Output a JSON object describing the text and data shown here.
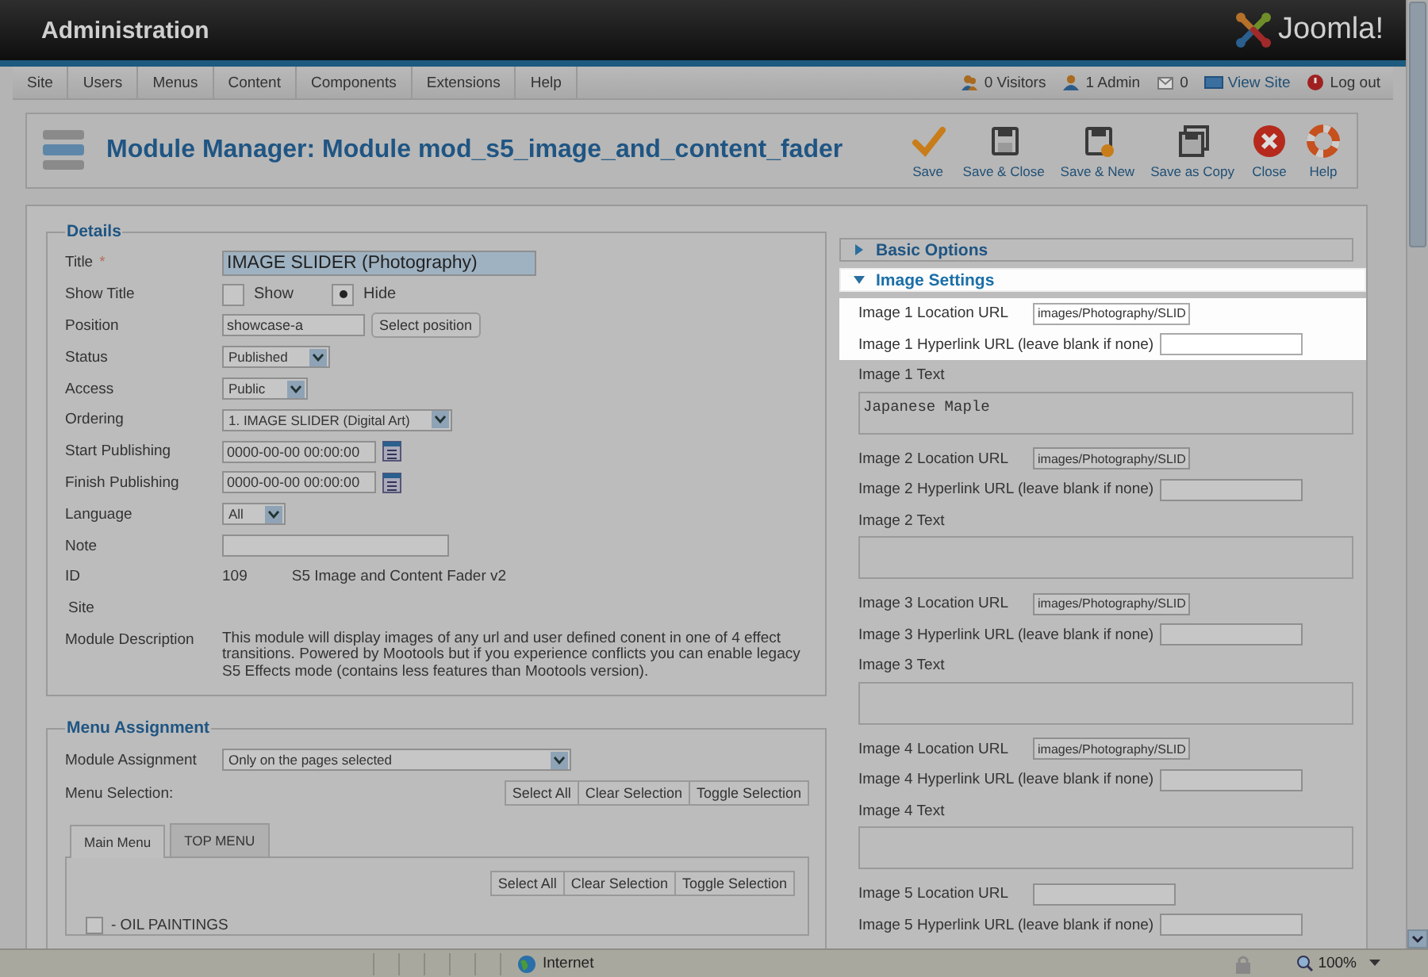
{
  "header": {
    "title": "Administration",
    "logo": "Joomla!"
  },
  "menu": [
    "Site",
    "Users",
    "Menus",
    "Content",
    "Components",
    "Extensions",
    "Help"
  ],
  "status_links": [
    {
      "label": "0 Visitors",
      "kind": "visitors"
    },
    {
      "label": "1 Admin",
      "kind": "admin"
    },
    {
      "label": "0",
      "kind": "messages"
    },
    {
      "label": "View Site",
      "kind": "view"
    },
    {
      "label": "Log out",
      "kind": "logout"
    }
  ],
  "toolbar": {
    "title": "Module Manager: Module mod_s5_image_and_content_fader",
    "buttons": [
      {
        "label": "Save",
        "kind": "save"
      },
      {
        "label": "Save & Close",
        "kind": "save_close"
      },
      {
        "label": "Save & New",
        "kind": "save_new"
      },
      {
        "label": "Save as Copy",
        "kind": "save_copy"
      },
      {
        "label": "Close",
        "kind": "close"
      },
      {
        "label": "Help",
        "kind": "help"
      }
    ]
  },
  "details": {
    "legend": "Details",
    "fields": [
      {
        "kind": "text",
        "label": "Title",
        "required": "*",
        "value": "IMAGE SLIDER (Photography)"
      },
      {
        "kind": "radio",
        "label": "Show Title",
        "options": [
          {
            "label": "Show",
            "selected": false
          },
          {
            "label": "Hide",
            "selected": true
          }
        ]
      },
      {
        "kind": "text_button",
        "label": "Position",
        "value": "showcase-a",
        "button": "Select position"
      },
      {
        "kind": "select",
        "label": "Status",
        "value": "Published"
      },
      {
        "kind": "select",
        "label": "Access",
        "value": "Public"
      },
      {
        "kind": "select",
        "label": "Ordering",
        "value": "1. IMAGE SLIDER (Digital Art)"
      },
      {
        "kind": "date",
        "label": "Start Publishing",
        "value": "0000-00-00 00:00:00"
      },
      {
        "kind": "date",
        "label": "Finish Publishing",
        "value": "0000-00-00 00:00:00"
      },
      {
        "kind": "select",
        "label": "Language",
        "value": "All"
      },
      {
        "kind": "text",
        "label": "Note"
      },
      {
        "kind": "info",
        "label": "ID",
        "value": "109",
        "extra": "S5 Image and Content Fader v2"
      },
      {
        "kind": "plain",
        "label": "Site"
      },
      {
        "kind": "paragraph",
        "label": "Module Description",
        "value": "This module will display images of any url and user defined conent in one of 4 effect transitions. Powered by Mootools but if you experience conflicts you can enable legacy S5 Effects mode (contains less features than Mootools version)."
      }
    ]
  },
  "menu_assignment": {
    "legend": "Menu Assignment",
    "module_assignment": {
      "label": "Module Assignment",
      "value": "Only on the pages selected"
    },
    "selection_label": "Menu Selection:",
    "buttons": [
      "Select All",
      "Clear Selection",
      "Toggle Selection"
    ],
    "tabs": [
      {
        "label": "Main Menu",
        "selected": true
      },
      {
        "label": "TOP MENU",
        "selected": false
      }
    ],
    "tab_buttons": [
      "Select All",
      "Clear Selection",
      "Toggle Selection"
    ],
    "items": [
      {
        "label": "- OIL PAINTINGS",
        "checked": false
      }
    ]
  },
  "panels": [
    {
      "title": "Basic Options",
      "expanded": false,
      "highlighted": false
    },
    {
      "title": "Image Settings",
      "expanded": true,
      "highlighted": true,
      "fields": [
        {
          "kind": "url",
          "label": "Image 1 Location URL",
          "value": "images/Photography/SLID",
          "highlighted": true
        },
        {
          "kind": "url",
          "label": "Image 1 Hyperlink URL (leave blank if none)",
          "highlighted": true
        },
        {
          "kind": "textarea",
          "label": "Image 1 Text",
          "value": "Japanese Maple",
          "highlighted": false
        },
        {
          "kind": "url",
          "label": "Image 2 Location URL",
          "value": "images/Photography/SLID",
          "highlighted": false
        },
        {
          "kind": "url",
          "label": "Image 2 Hyperlink URL (leave blank if none)",
          "highlighted": false
        },
        {
          "kind": "textarea",
          "label": "Image 2 Text",
          "highlighted": false
        },
        {
          "kind": "url",
          "label": "Image 3 Location URL",
          "value": "images/Photography/SLID",
          "highlighted": false
        },
        {
          "kind": "url",
          "label": "Image 3 Hyperlink URL (leave blank if none)",
          "highlighted": false
        },
        {
          "kind": "textarea",
          "label": "Image 3 Text",
          "highlighted": false
        },
        {
          "kind": "url",
          "label": "Image 4 Location URL",
          "value": "images/Photography/SLID",
          "highlighted": false
        },
        {
          "kind": "url",
          "label": "Image 4 Hyperlink URL (leave blank if none)",
          "highlighted": false
        },
        {
          "kind": "textarea",
          "label": "Image 4 Text",
          "highlighted": false
        },
        {
          "kind": "url",
          "label": "Image 5 Location URL",
          "highlighted": false
        },
        {
          "kind": "url",
          "label": "Image 5 Hyperlink URL (leave blank if none)",
          "highlighted": false
        }
      ]
    }
  ],
  "status_bar": {
    "zone": "Internet",
    "zoom": "100%"
  }
}
